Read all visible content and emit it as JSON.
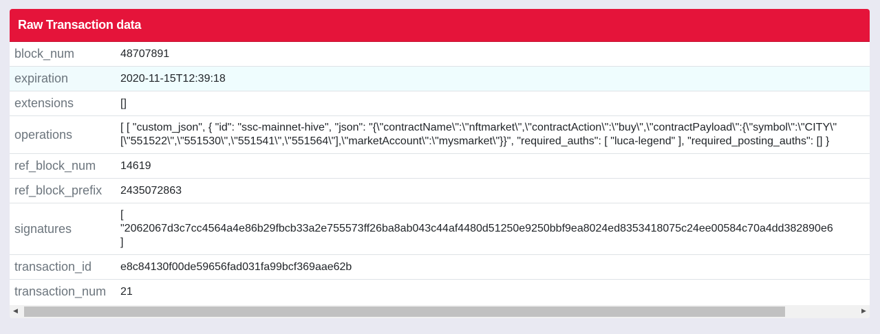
{
  "panel": {
    "title": "Raw Transaction data",
    "accent_color": "#e5143a"
  },
  "rows": [
    {
      "key": "block_num",
      "value": "48707891"
    },
    {
      "key": "expiration",
      "value": "2020-11-15T12:39:18"
    },
    {
      "key": "extensions",
      "value": "[]"
    },
    {
      "key": "operations",
      "line1": "[ [ \"custom_json\", { \"id\": \"ssc-mainnet-hive\", \"json\": \"{\\\"contractName\\\":\\\"nftmarket\\\",\\\"contractAction\\\":\\\"buy\\\",\\\"contractPayload\\\":{\\\"symbol\\\":\\\"CITY\\\"",
      "line2": "[\\\"551522\\\",\\\"551530\\\",\\\"551541\\\",\\\"551564\\\"],\\\"marketAccount\\\":\\\"mysmarket\\\"}}\", \"required_auths\": [ \"luca-legend\" ], \"required_posting_auths\": [] }"
    },
    {
      "key": "ref_block_num",
      "value": "14619"
    },
    {
      "key": "ref_block_prefix",
      "value": "2435072863"
    },
    {
      "key": "signatures",
      "line1": "[",
      "line2": "\"2062067d3c7cc4564a4e86b29fbcb33a2e755573ff26ba8ab043c44af4480d51250e9250bbf9ea8024ed8353418075c24ee00584c70a4dd382890e6",
      "line3": "]"
    },
    {
      "key": "transaction_id",
      "value": "e8c84130f00de59656fad031fa99bcf369aae62b"
    },
    {
      "key": "transaction_num",
      "value": "21"
    }
  ],
  "scrollbar": {
    "left_arrow": "◀",
    "right_arrow": "▶",
    "scroll_position": 0.0
  }
}
